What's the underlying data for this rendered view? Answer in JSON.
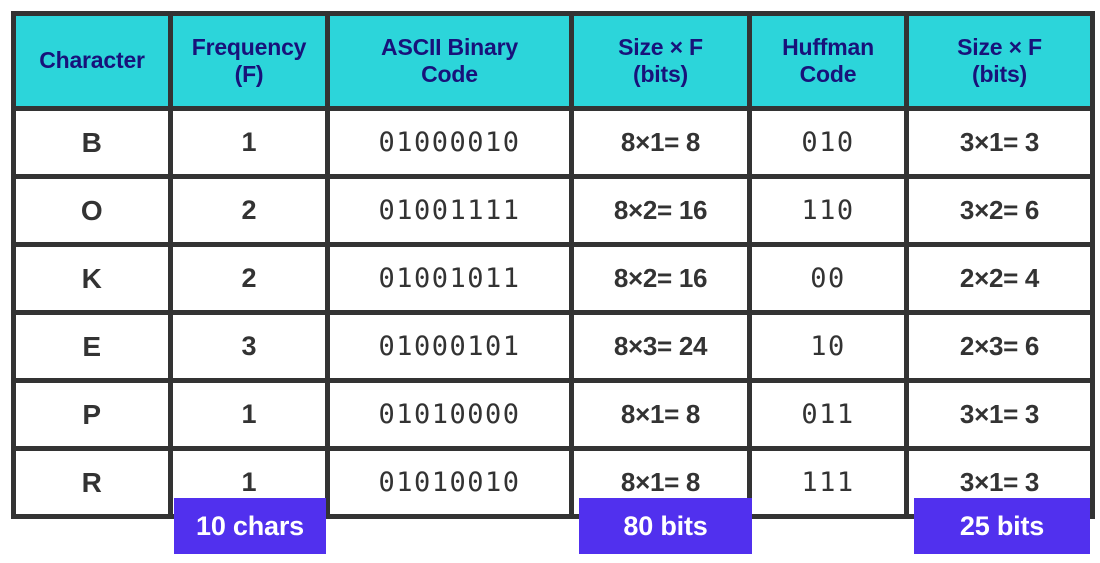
{
  "table": {
    "headers": [
      {
        "name": "character",
        "lines": [
          "Character"
        ]
      },
      {
        "name": "frequency",
        "lines": [
          "Frequency",
          "(F)"
        ]
      },
      {
        "name": "ascii-binary-code",
        "lines": [
          "ASCII Binary",
          "Code"
        ]
      },
      {
        "name": "ascii-size-times-f",
        "lines": [
          "Size × F",
          "(bits)"
        ]
      },
      {
        "name": "huffman-code",
        "lines": [
          "Huffman",
          "Code"
        ]
      },
      {
        "name": "huffman-size-times-f",
        "lines": [
          "Size × F",
          "(bits)"
        ]
      }
    ],
    "rows": [
      {
        "character": "B",
        "frequency": "1",
        "ascii_binary": "01000010",
        "ascii_size": "8×1= 8",
        "huffman_code": "010",
        "huffman_size": "3×1= 3"
      },
      {
        "character": "O",
        "frequency": "2",
        "ascii_binary": "01001111",
        "ascii_size": "8×2= 16",
        "huffman_code": "110",
        "huffman_size": "3×2= 6"
      },
      {
        "character": "K",
        "frequency": "2",
        "ascii_binary": "01001011",
        "ascii_size": "8×2= 16",
        "huffman_code": "00",
        "huffman_size": "2×2= 4"
      },
      {
        "character": "E",
        "frequency": "3",
        "ascii_binary": "01000101",
        "ascii_size": "8×3= 24",
        "huffman_code": "10",
        "huffman_size": "2×3= 6"
      },
      {
        "character": "P",
        "frequency": "1",
        "ascii_binary": "01010000",
        "ascii_size": "8×1= 8",
        "huffman_code": "011",
        "huffman_size": "3×1= 3"
      },
      {
        "character": "R",
        "frequency": "1",
        "ascii_binary": "01010010",
        "ascii_size": "8×1= 8",
        "huffman_code": "111",
        "huffman_size": "3×1= 3"
      }
    ]
  },
  "summary": {
    "total_chars": "10 chars",
    "total_ascii_bits": "80 bits",
    "total_huffman_bits": "25 bits"
  },
  "colors": {
    "header_background": "#2CD5DA",
    "header_text": "#18127A",
    "border": "#333333",
    "badge_background": "#5130EE",
    "badge_text": "#FFFFFF",
    "cell_text": "#333333",
    "page_background": "#FFFFFF"
  }
}
